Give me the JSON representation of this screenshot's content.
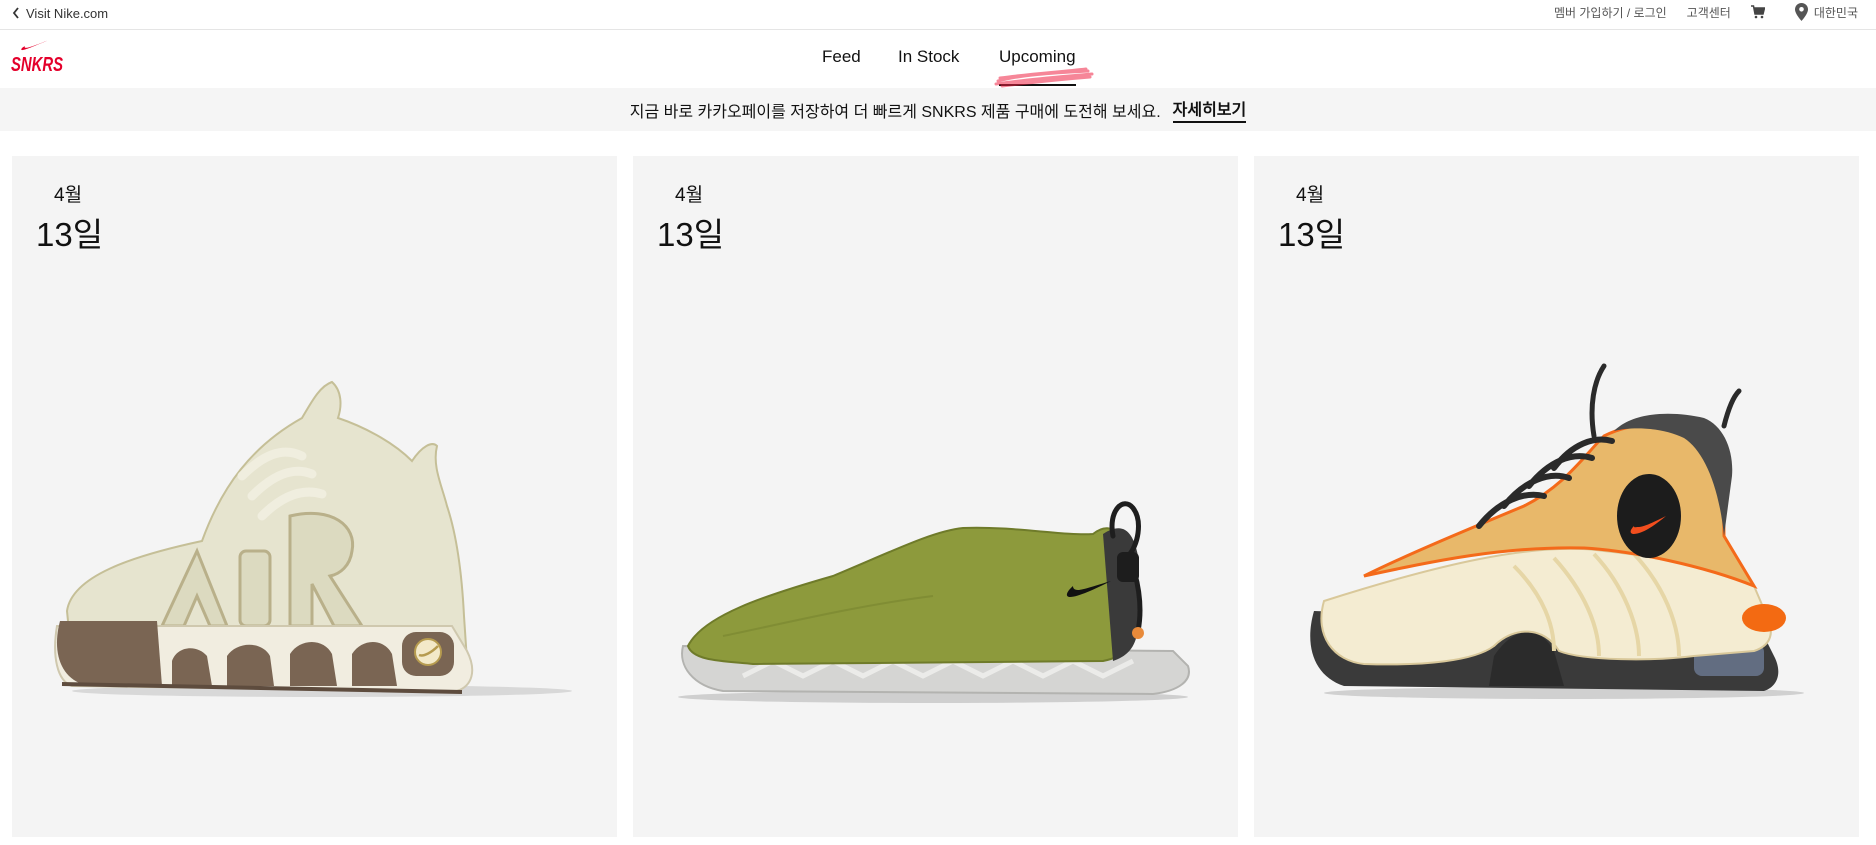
{
  "utility": {
    "visit_label": "Visit Nike.com",
    "join_login": "멤버 가입하기 / 로그인",
    "customer_service": "고객센터",
    "region": "대한민국"
  },
  "logo": {
    "text": "SNKRS",
    "color": "#e4002b"
  },
  "nav": {
    "tabs": [
      {
        "label": "Feed"
      },
      {
        "label": "In Stock"
      },
      {
        "label": "Upcoming",
        "active": true
      }
    ]
  },
  "promo": {
    "message": "지금 바로 카카오페이를 저장하여 더 빠르게 SNKRS 제품 구매에 도전해 보세요.",
    "link_label": "자세히보기"
  },
  "products": [
    {
      "month": "4월",
      "day": "13일",
      "icon": "sneaker-air-uptempo-image"
    },
    {
      "month": "4월",
      "day": "13일",
      "icon": "sneaker-acg-moc-image"
    },
    {
      "month": "4월",
      "day": "13일",
      "icon": "sneaker-penny-2-image"
    }
  ],
  "colors": {
    "accent_red": "#e4002b",
    "card_bg": "#f4f4f4",
    "banner_bg": "#f5f5f5"
  }
}
